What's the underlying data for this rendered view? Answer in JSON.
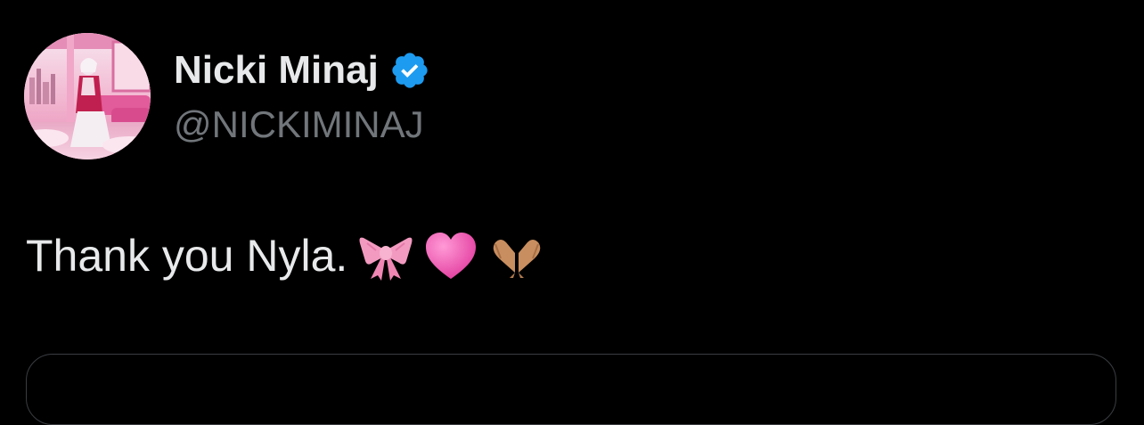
{
  "author": {
    "display_name": "Nicki Minaj",
    "handle": "@NICKIMINAJ",
    "verified": true,
    "verified_color": "#1d9bf0"
  },
  "tweet": {
    "text": "Thank you Nyla.",
    "emojis": [
      "ribbon-emoji",
      "pink-heart-emoji",
      "heart-hands-emoji"
    ]
  },
  "theme": {
    "background": "#000000",
    "text_primary": "#e7e9ea",
    "text_secondary": "#71767b",
    "border": "#3a3d41"
  }
}
